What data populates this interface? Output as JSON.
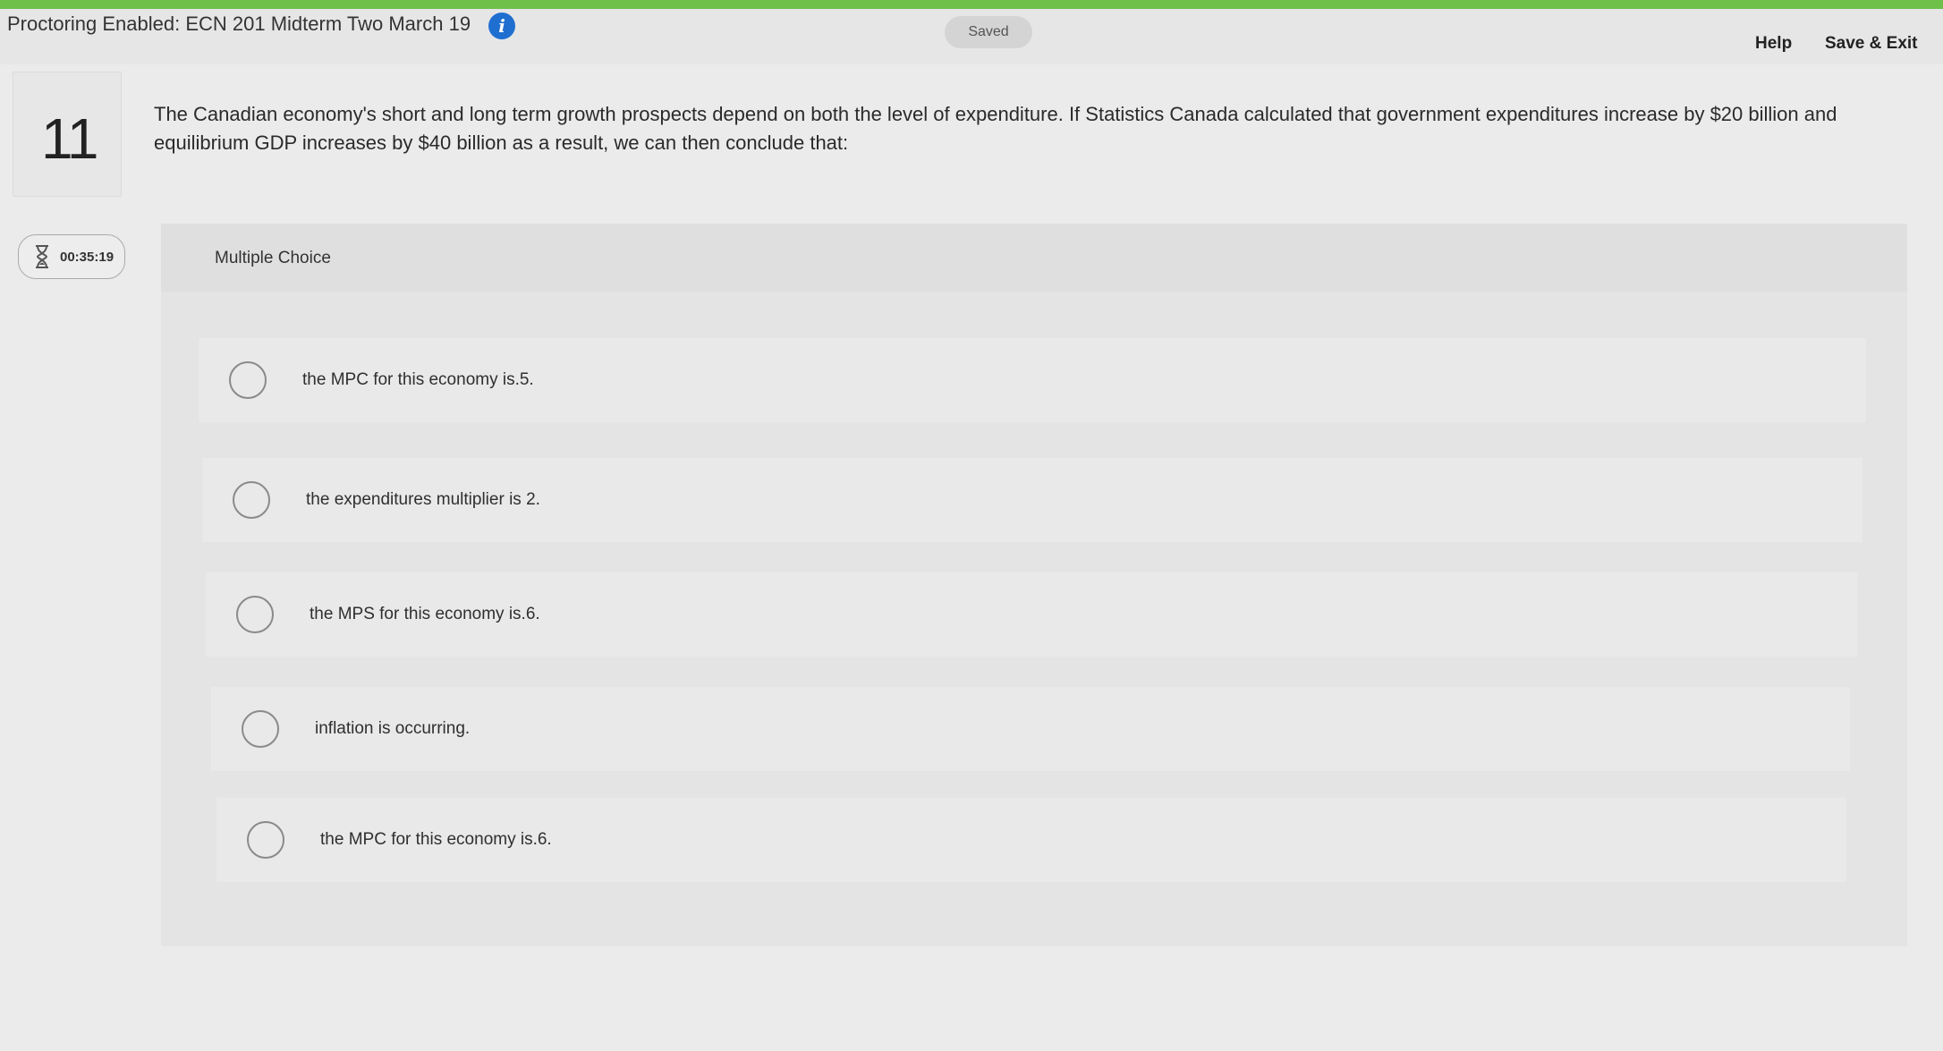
{
  "header": {
    "title": "Proctoring Enabled: ECN 201 Midterm Two March 19",
    "info_icon": "info-icon",
    "saved_label": "Saved",
    "help_label": "Help",
    "save_exit_label": "Save & Exit",
    "progress_color": "#6ec04b"
  },
  "question": {
    "number": "11",
    "prompt": "The Canadian economy's short and long term growth prospects depend on both the level of expenditure.  If Statistics Canada calculated that government expenditures increase by $20 billion and equilibrium GDP increases by $40 billion as a result, we can then conclude that:"
  },
  "timer": {
    "icon": "hourglass-icon",
    "time": "00:35:19"
  },
  "answer_panel": {
    "type_label": "Multiple Choice",
    "choices": [
      {
        "label": "the MPC for this economy is.5.",
        "selected": false
      },
      {
        "label": "the expenditures multiplier is 2.",
        "selected": false
      },
      {
        "label": "the MPS for this economy is.6.",
        "selected": false
      },
      {
        "label": "inflation is occurring.",
        "selected": false
      },
      {
        "label": "the MPC for this economy is.6.",
        "selected": false
      }
    ]
  }
}
